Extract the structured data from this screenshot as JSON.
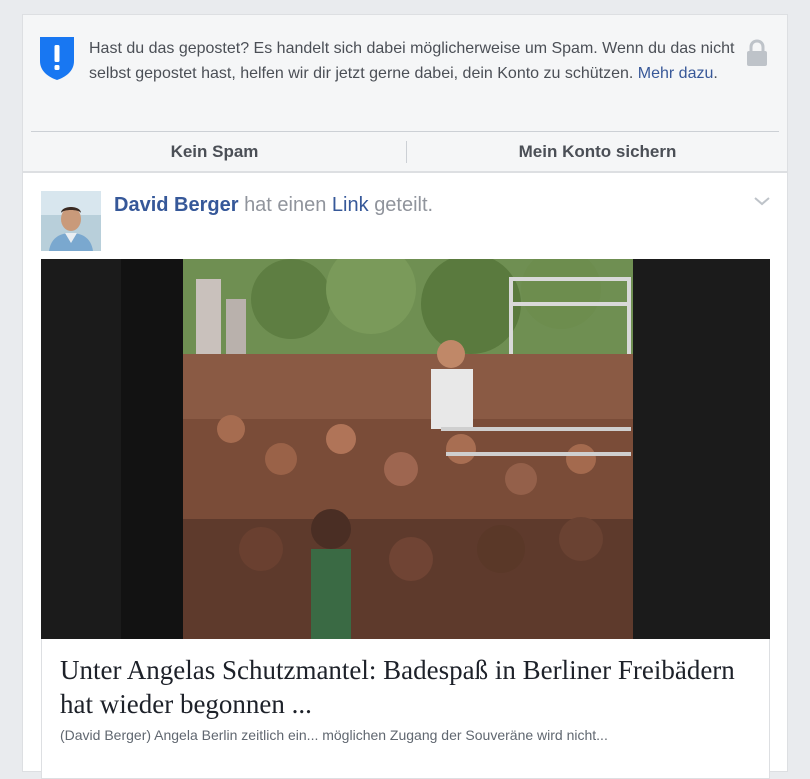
{
  "spam_warning": {
    "text": "Hast du das gepostet? Es handelt sich dabei möglicherweise um Spam. Wenn du das nicht selbst gepostet hast, helfen wir dir jetzt gerne dabei, dein Konto zu schützen.",
    "more_link": "Mehr dazu",
    "more_suffix": ".",
    "actions": {
      "not_spam": "Kein Spam",
      "secure_account": "Mein Konto sichern"
    },
    "icons": {
      "shield": "shield-alert-icon",
      "lock": "lock-icon"
    },
    "colors": {
      "shield": "#1877f2",
      "link": "#385898"
    }
  },
  "post": {
    "author": "David Berger",
    "action_pre": "hat einen",
    "action_link": "Link",
    "action_post": "geteilt.",
    "icons": {
      "menu": "chevron-down-icon"
    },
    "link_preview": {
      "title": "Unter Angelas Schutzmantel: Badespaß in Berliner Freibädern hat wieder begonnen ...",
      "description": "(David Berger) Angela Berlin zeitlich ein... möglichen Zugang der Souveräne wird nicht..."
    }
  }
}
